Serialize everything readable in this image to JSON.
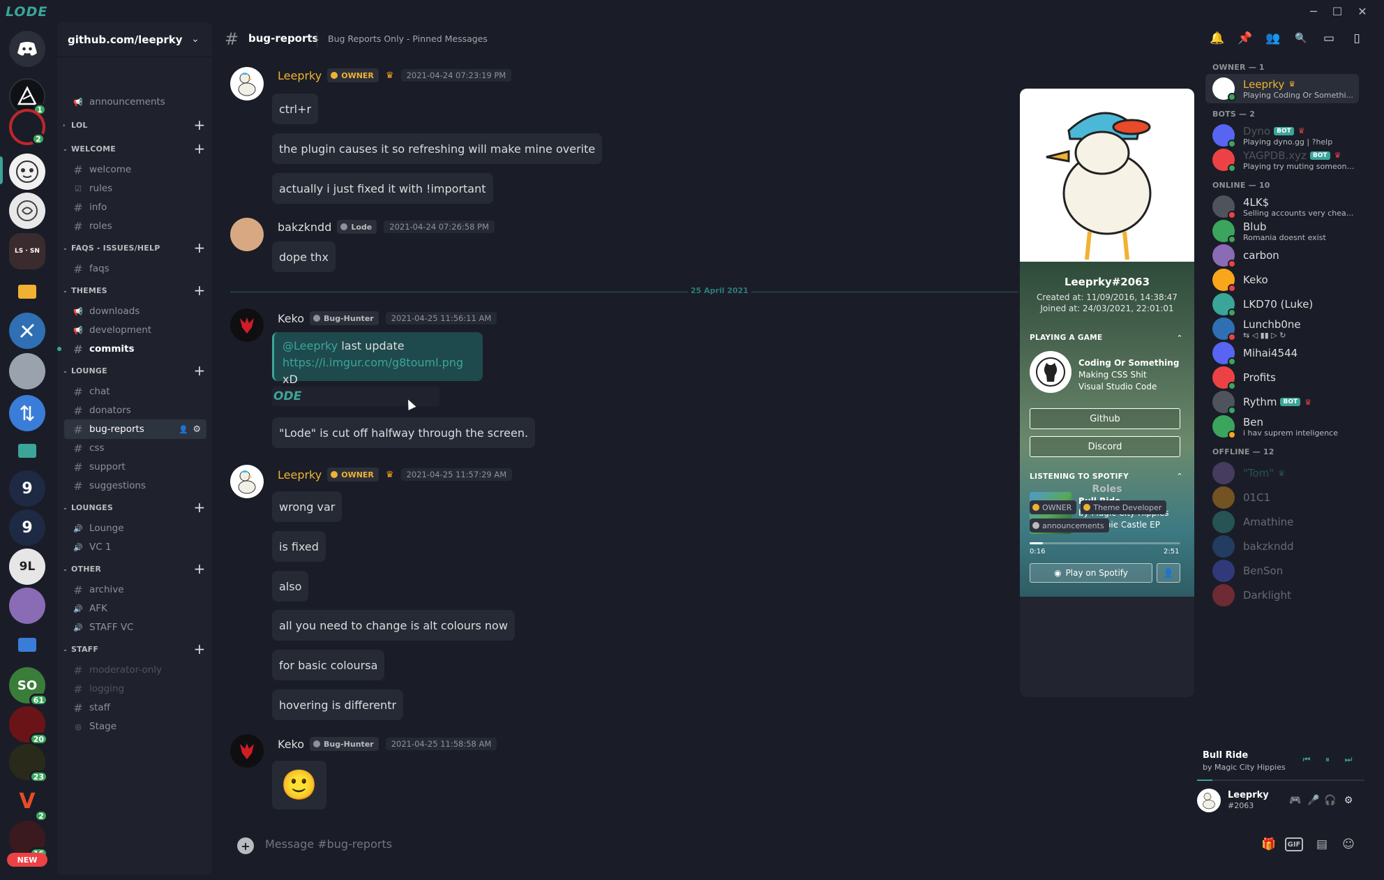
{
  "app": {
    "brand": "LODE",
    "window_controls": [
      "minimize-icon",
      "maximize-icon",
      "close-icon"
    ]
  },
  "guilds": [
    {
      "name": "home",
      "badge": ""
    },
    {
      "name": "server-1",
      "badge": "1"
    },
    {
      "name": "server-2",
      "badge": "2"
    },
    {
      "name": "server-3",
      "badge": ""
    },
    {
      "name": "server-4",
      "badge": ""
    },
    {
      "name": "server-5",
      "badge": ""
    },
    {
      "name": "server-so",
      "label": "SO",
      "badge": "61"
    },
    {
      "name": "server-20",
      "badge": "20"
    },
    {
      "name": "server-23",
      "badge": "23"
    },
    {
      "name": "server-v",
      "label": "V",
      "badge": "2"
    },
    {
      "name": "server-16",
      "badge": "16"
    }
  ],
  "guild_new_label": "NEW",
  "server": {
    "name": "github.com/leeprky"
  },
  "channel_list": {
    "top": {
      "name": "announcements",
      "icon": "megaphone-icon"
    },
    "categories": [
      {
        "name": "LOL",
        "collapsed": true,
        "channels": []
      },
      {
        "name": "WELCOME",
        "channels": [
          {
            "name": "welcome",
            "icon": "hash-icon"
          },
          {
            "name": "rules",
            "icon": "checkbox-icon"
          },
          {
            "name": "info",
            "icon": "hash-icon"
          },
          {
            "name": "roles",
            "icon": "hash-icon"
          }
        ]
      },
      {
        "name": "FAQS - ISSUES/HELP",
        "channels": [
          {
            "name": "faqs",
            "icon": "hash-icon"
          }
        ]
      },
      {
        "name": "THEMES",
        "channels": [
          {
            "name": "downloads",
            "icon": "megaphone-icon"
          },
          {
            "name": "development",
            "icon": "megaphone-icon"
          },
          {
            "name": "commits",
            "icon": "hash-icon",
            "unread": true
          }
        ]
      },
      {
        "name": "LOUNGE",
        "channels": [
          {
            "name": "chat",
            "icon": "hash-icon"
          },
          {
            "name": "donators",
            "icon": "hash-icon"
          },
          {
            "name": "bug-reports",
            "icon": "hash-icon",
            "active": true
          },
          {
            "name": "css",
            "icon": "hash-icon"
          },
          {
            "name": "support",
            "icon": "hash-icon"
          },
          {
            "name": "suggestions",
            "icon": "hash-icon"
          }
        ]
      },
      {
        "name": "LOUNGES",
        "channels": [
          {
            "name": "Lounge",
            "icon": "speaker-icon"
          },
          {
            "name": "VC 1",
            "icon": "speaker-icon"
          }
        ]
      },
      {
        "name": "OTHER",
        "channels": [
          {
            "name": "archive",
            "icon": "hash-icon"
          },
          {
            "name": "AFK",
            "icon": "speaker-icon"
          },
          {
            "name": "STAFF VC",
            "icon": "speaker-icon"
          }
        ]
      },
      {
        "name": "STAFF",
        "channels": [
          {
            "name": "moderator-only",
            "icon": "hash-icon",
            "muted": true
          },
          {
            "name": "logging",
            "icon": "hash-icon",
            "muted": true
          },
          {
            "name": "staff",
            "icon": "hash-icon"
          },
          {
            "name": "Stage",
            "icon": "stage-icon"
          }
        ]
      }
    ]
  },
  "chat": {
    "channel": "bug-reports",
    "topic": "Bug Reports Only - Pinned Messages",
    "header_icons": [
      "bell-icon",
      "pin-icon",
      "members-icon",
      "search-icon",
      "inbox-icon",
      "help-icon"
    ],
    "date_separator": "25 April 2021",
    "groups": [
      {
        "author": "Leeprky",
        "color": "#f0b232",
        "role": "OWNER",
        "role_color": "#f0b232",
        "crown": true,
        "timestamp": "2021-04-24 07:23:19 PM",
        "messages": [
          "ctrl+r",
          "the plugin causes it so refreshing will make mine overite",
          "actually i just fixed it with !important"
        ]
      },
      {
        "author": "bakzkndd",
        "color": "#dcddde",
        "role": "Lode",
        "role_color": "#8e9297",
        "crown": false,
        "timestamp": "2021-04-24 07:26:58 PM",
        "messages": [
          "dope thx"
        ]
      },
      {
        "author": "Keko",
        "color": "#dcddde",
        "role": "Bug-Hunter",
        "role_color": "#8e9297",
        "crown": false,
        "timestamp": "2021-04-25 11:56:11 AM",
        "messages": [
          "\"Lode\" is cut off halfway through the screen."
        ],
        "mention": {
          "user": "@Leeprky",
          "text": "last update",
          "link": "https://i.imgur.com/g8touml.png",
          "suffix": "xD"
        },
        "image_text": "ODE"
      },
      {
        "author": "Leeprky",
        "color": "#f0b232",
        "role": "OWNER",
        "role_color": "#f0b232",
        "crown": true,
        "timestamp": "2021-04-25 11:57:29 AM",
        "messages": [
          "wrong var",
          "is fixed",
          "also",
          "all you need to change is alt colours now",
          "for basic coloursa",
          "hovering is differentr"
        ]
      },
      {
        "author": "Keko",
        "color": "#dcddde",
        "role": "Bug-Hunter",
        "role_color": "#8e9297",
        "crown": false,
        "timestamp": "2021-04-25 11:58:58 AM",
        "messages": [
          "🙂"
        ]
      }
    ]
  },
  "composer": {
    "placeholder": "Message #bug-reports",
    "icons": [
      "gift-icon",
      "gif-icon",
      "sticker-icon",
      "emoji-icon"
    ],
    "gif_label": "GIF"
  },
  "profile": {
    "tag": "Leeprky#2063",
    "created": "Created at: 11/09/2016, 14:38:47",
    "joined": "Joined at: 24/03/2021, 22:01:01",
    "game_section": "PLAYING A GAME",
    "game_name": "Coding Or Something",
    "game_details": "Making CSS Shit",
    "game_state": "Visual Studio Code",
    "buttons": [
      "Github",
      "Discord"
    ],
    "spotify_section": "LISTENING TO SPOTIFY",
    "song": "Bull Ride",
    "artist": "by Magic City Hippies",
    "album": "on Hippie Castle EP",
    "elapsed": "0:16",
    "duration": "2:51",
    "progress": 0.09,
    "play_label": "Play on Spotify",
    "roles_title": "Roles",
    "roles": [
      {
        "name": "OWNER",
        "color": "#f0b232"
      },
      {
        "name": "Theme Developer",
        "color": "#f0b232"
      },
      {
        "name": "announcements",
        "color": "#b9bbbe"
      }
    ],
    "add_role": "+"
  },
  "members": {
    "categories": [
      {
        "title": "OWNER — 1",
        "members": [
          {
            "name": "Leeprky",
            "activity": "Playing Coding Or Somethi...",
            "color": "#f0b232",
            "status": "#3ba55d",
            "crown": true,
            "selected": true
          }
        ]
      },
      {
        "title": "BOTS — 2",
        "members": [
          {
            "name": "Dyno",
            "activity": "Playing dyno.gg | ?help",
            "color": "#4f545c",
            "bot": true,
            "bot_label": "BOT",
            "crown": true,
            "status": "#3ba55d"
          },
          {
            "name": "YAGPDB.xyz",
            "activity": "Playing try muting someone 9...",
            "color": "#4f545c",
            "bot": true,
            "bot_label": "BOT",
            "crown": true,
            "status": "#3ba55d"
          }
        ]
      },
      {
        "title": "ONLINE — 10",
        "members": [
          {
            "name": "4LK$",
            "activity": "Selling accounts very chea...",
            "status": "#ed4245"
          },
          {
            "name": "Blub",
            "activity": "Romania doesnt exist",
            "status": "#3ba55d"
          },
          {
            "name": "carbon",
            "activity": "",
            "status": "#ed4245"
          },
          {
            "name": "Keko",
            "activity": "",
            "status": "#ed4245"
          },
          {
            "name": "LKD70 (Luke)",
            "activity": "",
            "status": "#3ba55d"
          },
          {
            "name": "Lunchb0ne",
            "activity": "⇆  ◁  ▮▮  ▷  ↻",
            "status": "#ed4245"
          },
          {
            "name": "Mihai4544",
            "activity": "",
            "status": "#3ba55d"
          },
          {
            "name": "Profits",
            "activity": "",
            "status": "#3ba55d"
          },
          {
            "name": "Rythm",
            "activity": "",
            "bot": true,
            "bot_label": "BOT",
            "crown": true,
            "status": "#3ba55d"
          },
          {
            "name": "Ben",
            "activity": "i hav suprem inteligence",
            "status": "#faa61a"
          }
        ]
      },
      {
        "title": "OFFLINE — 12",
        "members": [
          {
            "name": "\"Tom\"",
            "activity": "",
            "color": "#3ba59a",
            "crown": true
          },
          {
            "name": "01C1",
            "activity": ""
          },
          {
            "name": "Amathine",
            "activity": ""
          },
          {
            "name": "bakzkndd",
            "activity": ""
          },
          {
            "name": "BenSon",
            "activity": ""
          },
          {
            "name": "Darklight",
            "activity": ""
          }
        ]
      }
    ]
  },
  "now_playing": {
    "title": "Bull Ride",
    "artist": "by Magic City Hippies",
    "progress": 0.09
  },
  "user": {
    "name": "Leeprky",
    "tag": "#2063",
    "controls": [
      "controller-icon",
      "microphone-icon",
      "headphones-icon",
      "settings-icon"
    ]
  }
}
